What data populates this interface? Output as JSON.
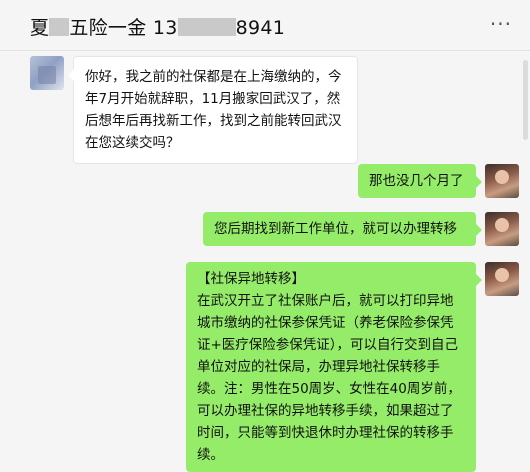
{
  "header": {
    "title_prefix": "夏",
    "title_middle": "五险一金 13",
    "title_suffix": "8941",
    "more_label": "···"
  },
  "messages": [
    {
      "side": "received",
      "lines": [
        "你好，我之前的社保都是在上海缴纳的，今",
        "年7月开始就辞职，11月搬家回武汉了，然",
        "后想年后再找新工作，找到之前能转回武汉",
        "在您这续交吗？"
      ]
    },
    {
      "side": "sent",
      "lines": [
        "那也没几个月了"
      ]
    },
    {
      "side": "sent",
      "lines": [
        "您后期找到新工作单位，就可以办理转移"
      ]
    },
    {
      "side": "sent",
      "lines": [
        "【社保异地转移】",
        "在武汉开立了社保账户后，就可以打印异地",
        "城市缴纳的社保参保凭证（养老保险参保凭",
        "证+医疗保险参保凭证），可以自行交到自己",
        "单位对应的社保局，办理异地社保转移手",
        "续。注：男性在50周岁、女性在40周岁前，",
        "可以办理社保的异地转移手续，如果超过了",
        "时间，只能等到快退休时办理社保的转移手",
        "续。"
      ]
    }
  ]
}
